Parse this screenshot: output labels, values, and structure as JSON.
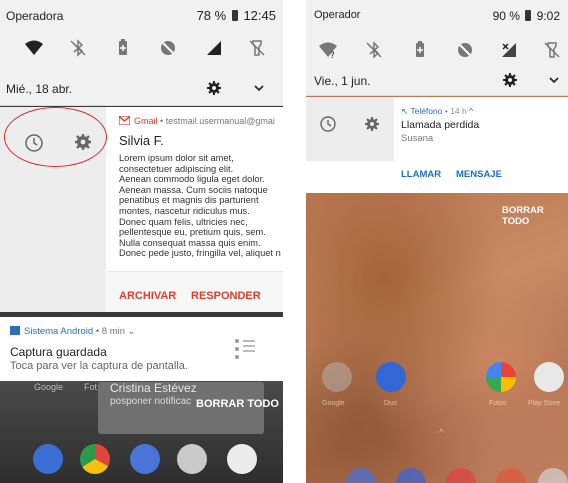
{
  "left": {
    "status": {
      "carrier": "Operadora",
      "battery": "78 %",
      "time": "12:45"
    },
    "quick_settings": [
      "wifi-icon",
      "bluetooth-off-icon",
      "battery-saver-icon",
      "do-not-disturb-icon",
      "signal-icon",
      "flashlight-off-icon"
    ],
    "date": "Mié., 18 abr.",
    "gmail": {
      "app": "Gmail",
      "account": "testmail.usermanual@gmai",
      "sender": "Silvia F.",
      "body": "Lorem ipsum dolor sit amet,\nconsectetuer adipiscing elit.\nAenean commodo ligula eget dolor.\nAenean massa. Cum sociis natoque\npenatibus et magnis dis parturient\nmontes, nascetur ridiculus mus.\nDonec quam felis, ultricies nec,\npellentesque eu, pretium quis, sem.\nNulla consequat massa quis enim.\nDonec pede justo, fringilla vel, aliquet n",
      "archive": "ARCHIVAR",
      "reply": "RESPONDER"
    },
    "screenshot": {
      "app": "Sistema Android",
      "meta": "• 8 min",
      "title": "Captura guardada",
      "subtitle": "Toca para ver la captura de pantalla."
    },
    "background": {
      "name": "Cristina Estévez",
      "sub": "posponer notificac",
      "apps": [
        "Google",
        "Fot"
      ],
      "clear_all": "BORRAR TODO"
    }
  },
  "right": {
    "status": {
      "carrier": "Operador",
      "battery": "90 %",
      "time": "9:02"
    },
    "quick_settings": [
      "wifi-question-icon",
      "bluetooth-off-icon",
      "battery-saver-icon",
      "do-not-disturb-icon",
      "no-signal-icon",
      "flashlight-off-icon"
    ],
    "date": "Vie., 1 jun.",
    "phone": {
      "app": "Teléfono",
      "meta": "• 14 h",
      "title": "Llamada perdida",
      "subtitle": "Susana",
      "call": "LLAMAR",
      "message": "MENSAJE"
    },
    "clear_all": "BORRAR TODO",
    "apps": [
      "Google",
      "Duo",
      "Fotos",
      "Play Store"
    ]
  }
}
